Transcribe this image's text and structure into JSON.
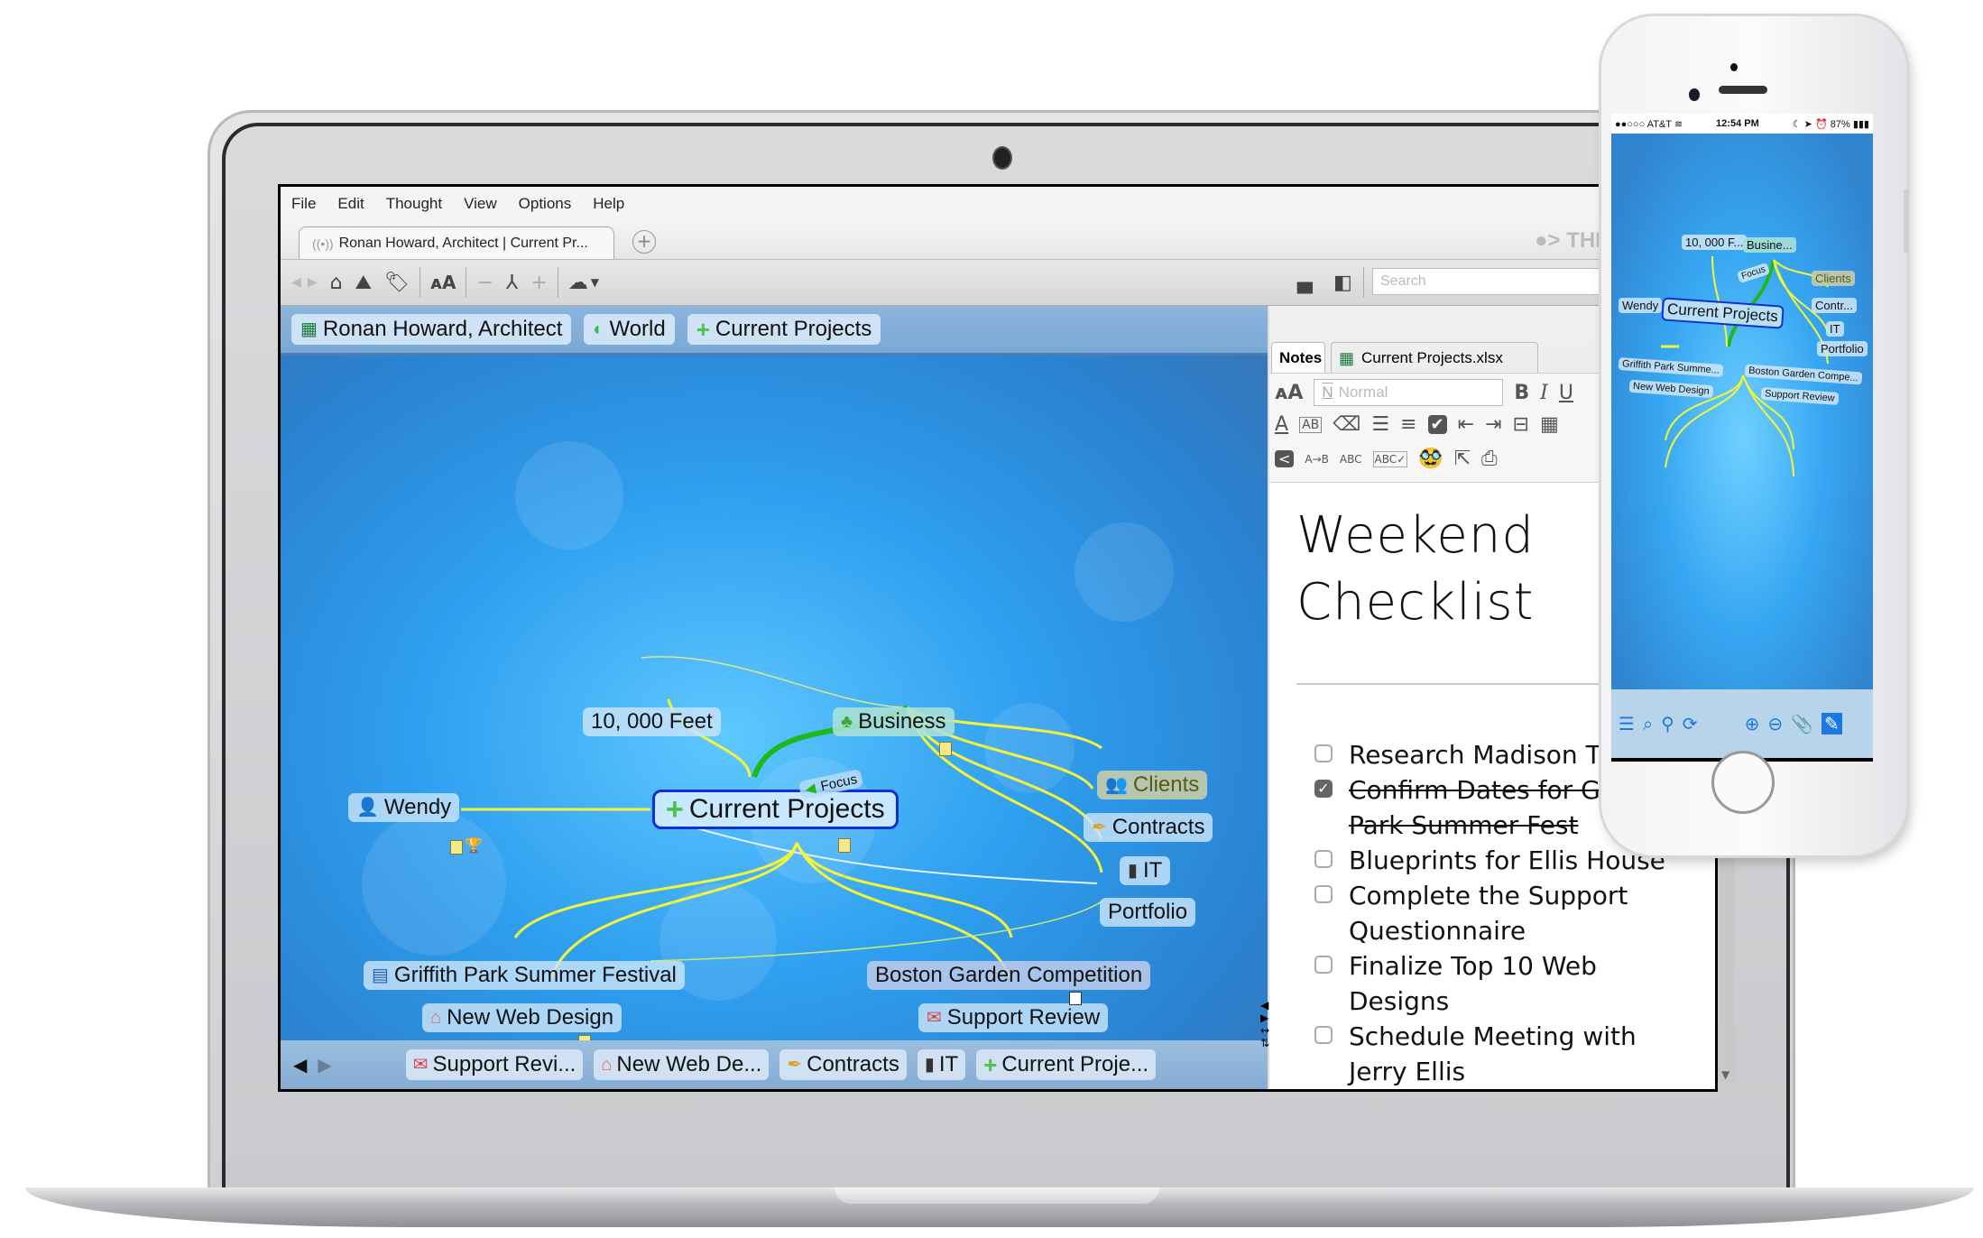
{
  "app": {
    "menu": [
      "File",
      "Edit",
      "Thought",
      "View",
      "Options",
      "Help"
    ],
    "tab_title": "Ronan Howard, Architect | Current Pr...",
    "add_tab_icon": "plus-circle-icon",
    "logo_text": "THE BRAIN",
    "toolbar": {
      "icons": [
        "back-arrow-icon",
        "forward-arrow-icon",
        "home-icon",
        "map-pin-icon",
        "tag-icon",
        "font-size-icon",
        "collapse-minus-icon",
        "network-icon",
        "expand-plus-icon",
        "cloud-icon",
        "dropdown-caret-icon"
      ],
      "layout_icons": [
        "bottom-panel-icon",
        "right-panel-icon"
      ],
      "search_placeholder": "Search"
    }
  },
  "map": {
    "breadcrumbs": [
      {
        "label": "Ronan Howard, Architect",
        "icon": "excel-icon"
      },
      {
        "label": "World",
        "icon": "world-icon"
      },
      {
        "label": "Current Projects",
        "icon": "plus-icon"
      }
    ],
    "central_node": "Current Projects",
    "link_label": "Focus",
    "nodes": [
      {
        "label": "10, 000 Feet",
        "icon": ""
      },
      {
        "label": "Business",
        "icon": "clover-icon"
      },
      {
        "label": "Clients",
        "icon": "people-icon"
      },
      {
        "label": "Contracts",
        "icon": "pen-icon"
      },
      {
        "label": "IT",
        "icon": "server-icon"
      },
      {
        "label": "Portfolio",
        "icon": ""
      },
      {
        "label": "Wendy",
        "icon": "person-icon"
      },
      {
        "label": "Griffith Park Summer Festival",
        "icon": "word-doc-icon"
      },
      {
        "label": "New Web Design",
        "icon": "house-icon"
      },
      {
        "label": "Boston Garden Competition",
        "icon": ""
      },
      {
        "label": "Support Review",
        "icon": "certificate-icon"
      }
    ],
    "pins_nav": [
      "previous-icon",
      "next-icon"
    ],
    "pins": [
      {
        "label": "Support Revi...",
        "icon": "certificate-icon"
      },
      {
        "label": "New Web De...",
        "icon": "house-icon"
      },
      {
        "label": "Contracts",
        "icon": "pen-icon"
      },
      {
        "label": "IT",
        "icon": "server-icon"
      },
      {
        "label": "Current Proje...",
        "icon": "plus-icon"
      }
    ]
  },
  "notes": {
    "tabs": [
      "Notes",
      "Current Projects.xlsx"
    ],
    "style_placeholder": "Normal",
    "format_row1": [
      "font-size-icon",
      "bold-icon",
      "italic-icon",
      "underline-icon"
    ],
    "format_row2": [
      "font-color-icon",
      "highlight-icon",
      "eraser-icon",
      "bullet-list-icon",
      "numbered-list-icon",
      "checkbox-list-icon",
      "outdent-icon",
      "indent-icon",
      "horizontal-rule-icon",
      "calendar-icon"
    ],
    "format_row3": [
      "collapse-icon",
      "find-replace-icon",
      "spell-numbers-icon",
      "spellcheck-icon",
      "incognito-icon",
      "export-icon",
      "print-icon"
    ],
    "title": "Weekend Checklist",
    "checklist": [
      {
        "text": "Research Madison Trip",
        "checked": false
      },
      {
        "text": "Confirm Dates for Griffith Park Summer Fest",
        "checked": true
      },
      {
        "text": "Blueprints for Ellis House",
        "checked": false
      },
      {
        "text": "Complete the Support Questionnaire",
        "checked": false
      },
      {
        "text": "Finalize Top 10 Web Designs",
        "checked": false
      },
      {
        "text": "Schedule Meeting with Jerry Ellis",
        "checked": false
      }
    ]
  },
  "phone": {
    "carrier": "●●○○○ AT&T",
    "time": "12:54 PM",
    "battery": "87%",
    "nodes": [
      "10, 000 F...",
      "Busine...",
      "Clients",
      "Contr...",
      "IT",
      "Portfolio",
      "Wendy",
      "Current Projects",
      "Griffith Park Summe...",
      "New Web Design",
      "Boston Garden Compe...",
      "Support Review"
    ],
    "link_label": "Focus",
    "toolbar_icons": [
      "menu-icon",
      "search-icon",
      "pin-icon",
      "sync-icon",
      "zoom-in-icon",
      "zoom-out-icon",
      "attachment-icon",
      "edit-icon"
    ]
  },
  "colors": {
    "link_yellow": "#f5f53a",
    "focus_green": "#1cb81c",
    "map_blue": "#2f9ff0",
    "central_border": "#1030d0",
    "phone_toolbar_icon": "#1b78e0"
  }
}
